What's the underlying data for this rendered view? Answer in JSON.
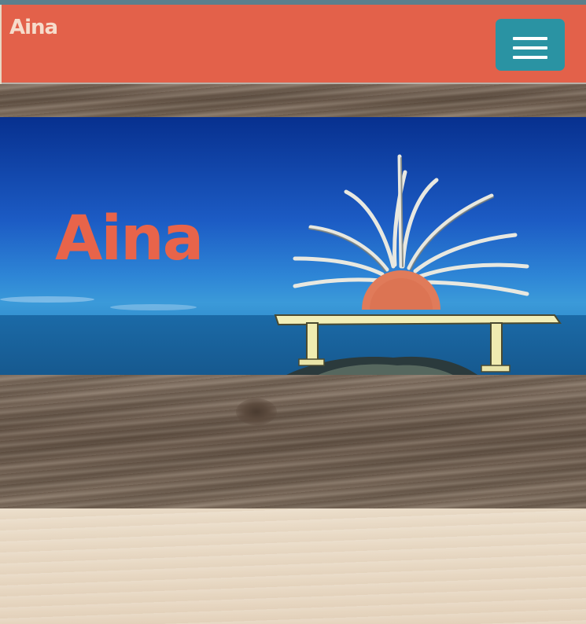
{
  "theme": {
    "accent": "#e3614a",
    "menu_button_color": "#2a93a3",
    "hero_title_color": "#e8644a"
  },
  "navbar": {
    "brand": "Aina",
    "menu_icon": "hamburger-menu-icon"
  },
  "hero": {
    "title": "Aina",
    "image": "bench-with-sun-sculpture-over-sea"
  }
}
